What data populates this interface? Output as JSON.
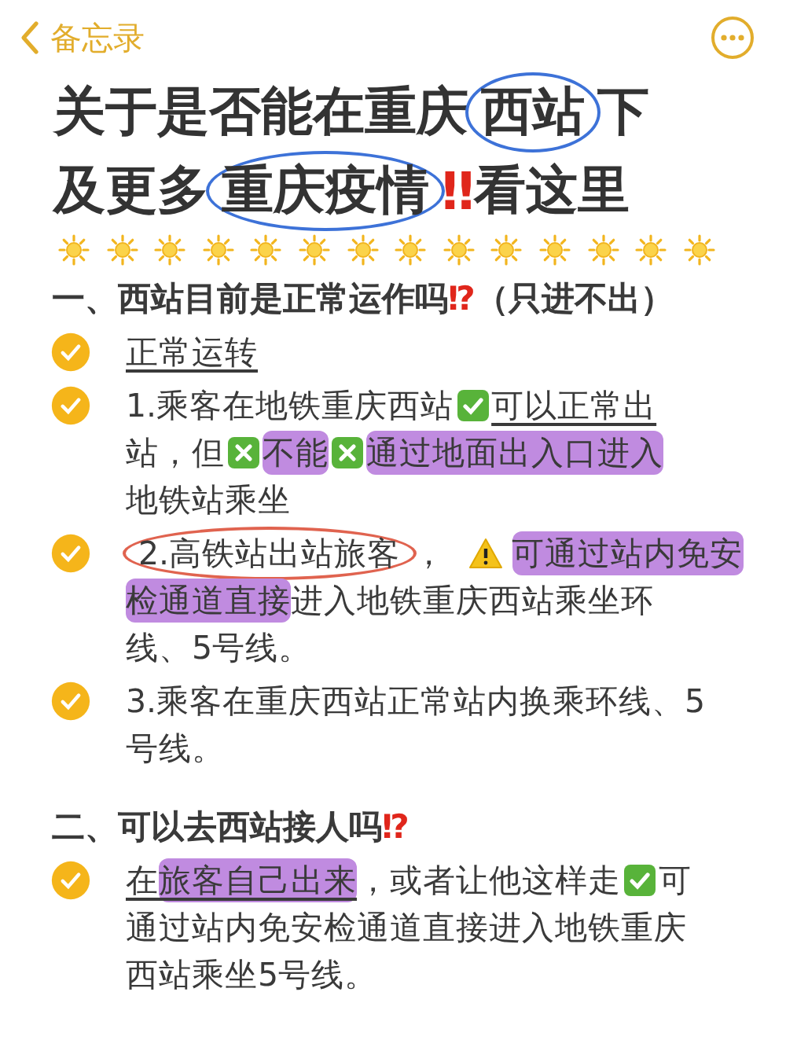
{
  "nav": {
    "back_label": "备忘录"
  },
  "title": {
    "lines": [
      [
        {
          "kind": "plain",
          "text": "关于是否能在重庆"
        },
        {
          "kind": "circled",
          "text": "西站",
          "color": "#3d72d8"
        },
        {
          "kind": "plain",
          "text": "下"
        }
      ],
      [
        {
          "kind": "plain",
          "text": "及更多"
        },
        {
          "kind": "circled",
          "text": "重庆疫情",
          "color": "#3d72d8"
        },
        {
          "kind": "alert",
          "text": "‼"
        },
        {
          "kind": "plain",
          "text": "看这里"
        }
      ]
    ]
  },
  "sections": [
    {
      "heading": [
        {
          "kind": "plain",
          "text": "一、西站目前是正常运作吗"
        },
        {
          "kind": "alert",
          "text": "⁉"
        },
        {
          "kind": "plain",
          "text": "（只进不出）"
        }
      ],
      "items": [
        {
          "checked": true,
          "lines": [
            [
              {
                "kind": "underlined",
                "text": "正常运转"
              }
            ]
          ]
        },
        {
          "checked": true,
          "lines": [
            [
              {
                "kind": "plain",
                "text": "1.乘客在地铁重庆西站"
              },
              {
                "kind": "check"
              },
              {
                "kind": "underlined",
                "text": "可以正常出"
              }
            ],
            [
              {
                "kind": "plain",
                "text": "站，但"
              },
              {
                "kind": "cross"
              },
              {
                "kind": "highlighted",
                "text": "不能"
              },
              {
                "kind": "cross"
              },
              {
                "kind": "highlighted",
                "text": "通过地面出入口进入"
              }
            ],
            [
              {
                "kind": "plain",
                "text": "地铁站乘坐"
              }
            ]
          ]
        },
        {
          "checked": true,
          "lines": [
            [
              {
                "kind": "circled",
                "text": "2.高铁站出站旅客",
                "color": "#e0634f"
              },
              {
                "kind": "plain",
                "text": "，"
              },
              {
                "kind": "warning"
              },
              {
                "kind": "highlighted",
                "text": "可通过站内免安"
              }
            ],
            [
              {
                "kind": "highlighted",
                "text": "检通道直接"
              },
              {
                "kind": "plain",
                "text": "进入地铁重庆西站乘坐环"
              }
            ],
            [
              {
                "kind": "plain",
                "text": "线、5号线。"
              }
            ]
          ]
        },
        {
          "checked": true,
          "lines": [
            [
              {
                "kind": "plain",
                "text": "3.乘客在重庆西站正常站内换乘环线、5"
              }
            ],
            [
              {
                "kind": "plain",
                "text": "号线。"
              }
            ]
          ]
        }
      ]
    },
    {
      "heading": [
        {
          "kind": "plain",
          "text": "二、可以去西站接人吗"
        },
        {
          "kind": "alert",
          "text": "⁉"
        }
      ],
      "items": [
        {
          "checked": true,
          "lines": [
            [
              {
                "kind": "underlined",
                "text": "在"
              },
              {
                "kind": "highlighted-underlined",
                "text": "旅客自己出来"
              },
              {
                "kind": "plain",
                "text": "，或者让他这样走"
              },
              {
                "kind": "check"
              },
              {
                "kind": "plain",
                "text": "可"
              }
            ],
            [
              {
                "kind": "plain",
                "text": "通过站内免安检通道直接进入地铁重庆"
              }
            ],
            [
              {
                "kind": "plain",
                "text": "西站乘坐5号线。"
              }
            ]
          ]
        }
      ]
    }
  ]
}
